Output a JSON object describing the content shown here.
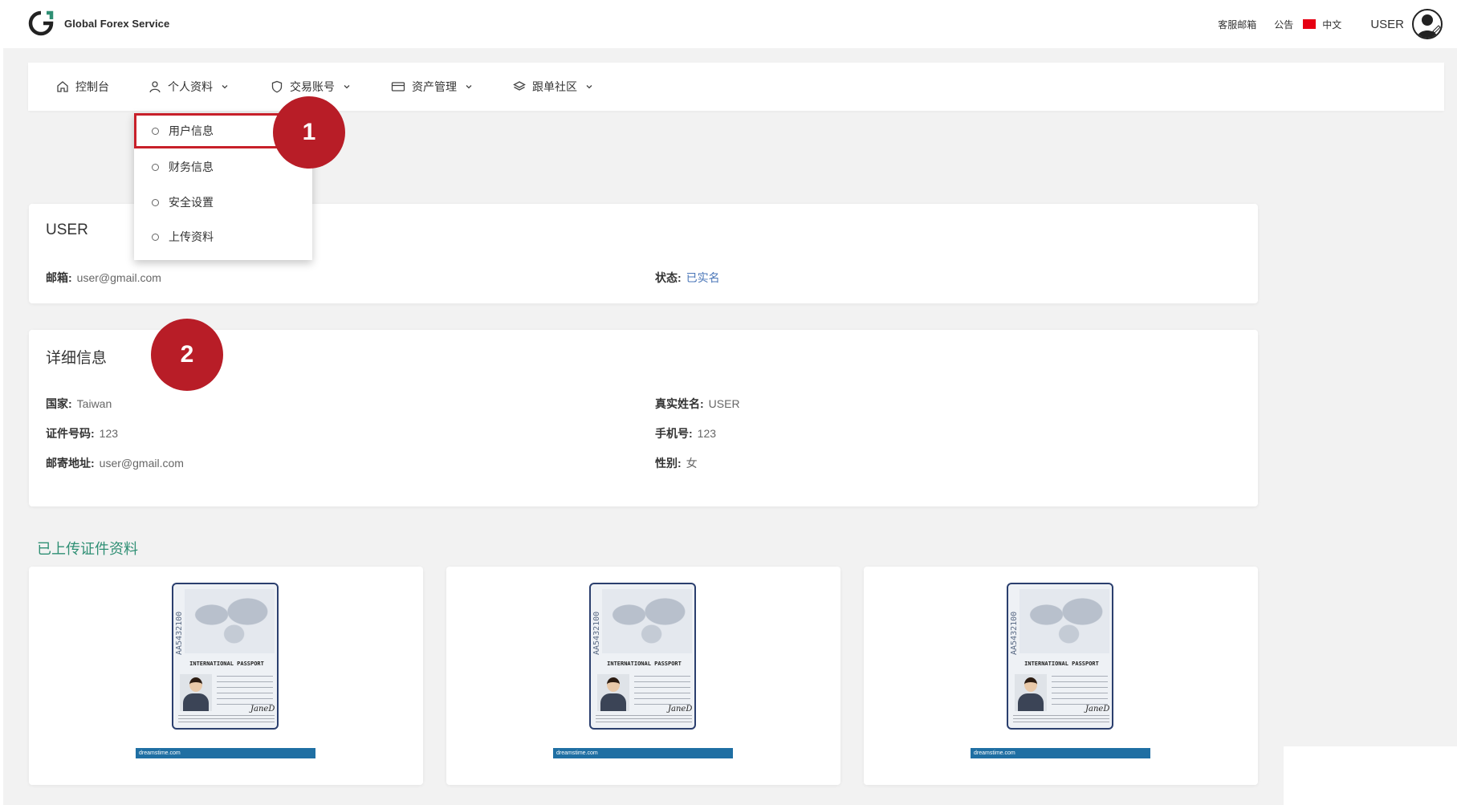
{
  "header": {
    "brand_name": "Global Forex Service",
    "links": [
      "客服邮箱",
      "公告"
    ],
    "language": "中文",
    "user": "USER"
  },
  "nav": {
    "items": [
      {
        "label": "控制台",
        "icon": "home-icon",
        "has_dropdown": false
      },
      {
        "label": "个人资料",
        "icon": "user-icon",
        "has_dropdown": true
      },
      {
        "label": "交易账号",
        "icon": "shield-icon",
        "has_dropdown": true
      },
      {
        "label": "资产管理",
        "icon": "card-icon",
        "has_dropdown": true
      },
      {
        "label": "跟单社区",
        "icon": "layers-icon",
        "has_dropdown": true
      }
    ]
  },
  "dropdown": {
    "items": [
      "用户信息",
      "财务信息",
      "安全设置",
      "上传资料"
    ],
    "active_index": 0
  },
  "badges": [
    "1",
    "2"
  ],
  "account_card": {
    "title": "USER",
    "email_label": "邮箱:",
    "email_value": "user@gmail.com",
    "status_label": "状态:",
    "status_value": "已实名"
  },
  "detail_card": {
    "title": "详细信息",
    "fields": [
      {
        "label": "国家:",
        "value": "Taiwan"
      },
      {
        "label": "真实姓名:",
        "value": "USER"
      },
      {
        "label": "证件号码:",
        "value": "123"
      },
      {
        "label": "手机号:",
        "value": "123"
      },
      {
        "label": "邮寄地址:",
        "value": "user@gmail.com"
      },
      {
        "label": "性别:",
        "value": "女"
      }
    ]
  },
  "uploads": {
    "title": "已上传证件资料",
    "documents": [
      {
        "title": "INTERNATIONAL PASSPORT",
        "number": "AA5432100",
        "signature": "JaneD",
        "footer": "dreamstime.com"
      },
      {
        "title": "INTERNATIONAL PASSPORT",
        "number": "AA5432100",
        "signature": "JaneD",
        "footer": "dreamstime.com"
      },
      {
        "title": "INTERNATIONAL PASSPORT",
        "number": "AA5432100",
        "signature": "JaneD",
        "footer": "dreamstime.com"
      }
    ]
  },
  "colors": {
    "accent_green": "#2f8f74",
    "badge_red": "#b81d27",
    "status_blue": "#4a76b8"
  }
}
